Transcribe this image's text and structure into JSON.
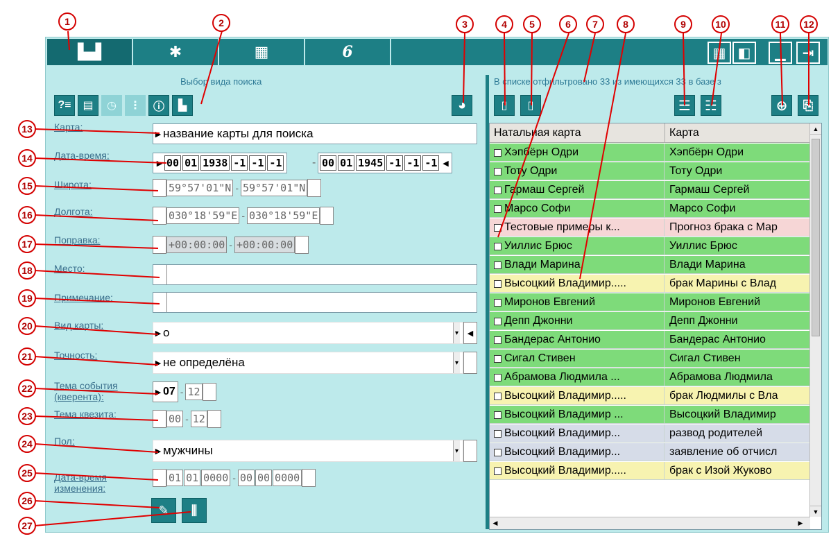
{
  "toolbar": {
    "tabs": [
      {
        "icon": "binoculars-icon",
        "glyph": "▙▟"
      },
      {
        "icon": "gear-icon",
        "glyph": "✱"
      },
      {
        "icon": "calculator-icon",
        "glyph": "▦"
      },
      {
        "icon": "signature-icon",
        "glyph": "6"
      }
    ],
    "right_icons": [
      "grid-icon",
      "panel-icon",
      "minimize-icon",
      "exit-icon"
    ],
    "right_glyphs": [
      "▦",
      "◧",
      "▁",
      "⇥"
    ]
  },
  "left_panel": {
    "title": "Выбор вида поиска",
    "mode_buttons": [
      {
        "icon": "question-list-icon",
        "glyph": "?≡"
      },
      {
        "icon": "list-book-icon",
        "glyph": "▤"
      },
      {
        "icon": "list-clock-icon",
        "glyph": "◷"
      },
      {
        "icon": "list-tree-icon",
        "glyph": "⋮"
      },
      {
        "icon": "info-icon",
        "glyph": "ⓘ"
      },
      {
        "icon": "binoculars-search-icon",
        "glyph": "▙"
      }
    ],
    "pie_icon": "◕",
    "fields": {
      "map_label": "Карта:",
      "map_value": "название карты для поиска",
      "datetime_label": "Дата-время:",
      "datetime_from": [
        "00",
        "01",
        "1938",
        "-1",
        "-1",
        "-1"
      ],
      "datetime_to": [
        "00",
        "01",
        "1945",
        "-1",
        "-1",
        "-1"
      ],
      "lat_label": "Широта:",
      "lat_from": "59°57'01\"N",
      "lat_to": "59°57'01\"N",
      "lon_label": "Долгота:",
      "lon_from": "030°18'59\"E",
      "lon_to": "030°18'59\"E",
      "corr_label": "Поправка:",
      "corr_from": "+00:00:00",
      "corr_to": "+00:00:00",
      "place_label": "Место:",
      "note_label": "Примечание:",
      "kind_label": "Вид карты:",
      "kind_value": "о",
      "accuracy_label": "Точность:",
      "accuracy_value": "не определёна",
      "theme_label": "Тема события (кверента):",
      "theme_from": "07",
      "theme_to": "12",
      "quesited_label": "Тема квезита:",
      "quesited_from": "00",
      "quesited_to": "12",
      "sex_label": "Пол:",
      "sex_value": "мужчины",
      "changed_label": "Дата-время изменения:",
      "changed_from": [
        "01",
        "01",
        "0000"
      ],
      "changed_to": [
        "00",
        "00",
        "0000"
      ]
    },
    "bottom_buttons": [
      "edit-filter-icon",
      "sliders-icon"
    ]
  },
  "right_panel": {
    "status": "В списке отфильтровано 33 из имеющихся 33 в базе з",
    "columns": [
      "Натальная карта",
      "Карта"
    ],
    "rows": [
      {
        "c1": "Хэпбёрн Одри",
        "c2": "Хэпбёрн Одри",
        "color": "#7edb7a"
      },
      {
        "c1": "Тоту Одри",
        "c2": "Тоту Одри",
        "color": "#7edb7a"
      },
      {
        "c1": "Гармаш Сергей",
        "c2": "Гармаш Сергей",
        "color": "#7edb7a"
      },
      {
        "c1": "Марсо Софи",
        "c2": "Марсо Софи",
        "color": "#7edb7a"
      },
      {
        "c1": "Тестовые примеры к...",
        "c2": "Прогноз брака с Мар",
        "color": "#f6d6d6"
      },
      {
        "c1": "Уиллис Брюс",
        "c2": "Уиллис Брюс",
        "color": "#7edb7a"
      },
      {
        "c1": "Влади Марина",
        "c2": "Влади Марина",
        "color": "#7edb7a"
      },
      {
        "c1": "Высоцкий Владимир.....",
        "c2": "брак Марины с Влад",
        "color": "#f7f3b0"
      },
      {
        "c1": "Миронов Евгений",
        "c2": "Миронов Евгений",
        "color": "#7edb7a"
      },
      {
        "c1": "Депп Джонни",
        "c2": "Депп Джонни",
        "color": "#7edb7a"
      },
      {
        "c1": "Бандерас Антонио",
        "c2": "Бандерас Антонио",
        "color": "#7edb7a"
      },
      {
        "c1": "Сигал Стивен",
        "c2": "Сигал Стивен",
        "color": "#7edb7a"
      },
      {
        "c1": "Абрамова Людмила ...",
        "c2": "Абрамова Людмила",
        "color": "#7edb7a"
      },
      {
        "c1": "Высоцкий Владимир.....",
        "c2": "брак Людмилы с Вла",
        "color": "#f7f3b0"
      },
      {
        "c1": "Высоцкий Владимир ...",
        "c2": "Высоцкий Владимир",
        "color": "#7edb7a"
      },
      {
        "c1": "Высоцкий Владимир...",
        "c2": "развод родителей",
        "color": "#d6dce8"
      },
      {
        "c1": "Высоцкий Владимир...",
        "c2": "заявление об отчисл",
        "color": "#d6dce8"
      },
      {
        "c1": "Высоцкий Владимир.....",
        "c2": "брак с Изой Жуково",
        "color": "#f7f3b0"
      }
    ],
    "tool_icons": [
      "card-left-icon",
      "card-right-icon",
      "list-red-icon",
      "list-green-icon",
      "crosshair-icon",
      "export-icon"
    ]
  },
  "callouts": [
    "1",
    "2",
    "3",
    "4",
    "5",
    "6",
    "7",
    "8",
    "9",
    "10",
    "11",
    "12",
    "13",
    "14",
    "15",
    "16",
    "17",
    "18",
    "19",
    "20",
    "21",
    "22",
    "23",
    "24",
    "25",
    "26",
    "27"
  ],
  "colors": {
    "accent": "#1d7f85",
    "panel": "#bdeaeb",
    "callout": "#d40000"
  }
}
